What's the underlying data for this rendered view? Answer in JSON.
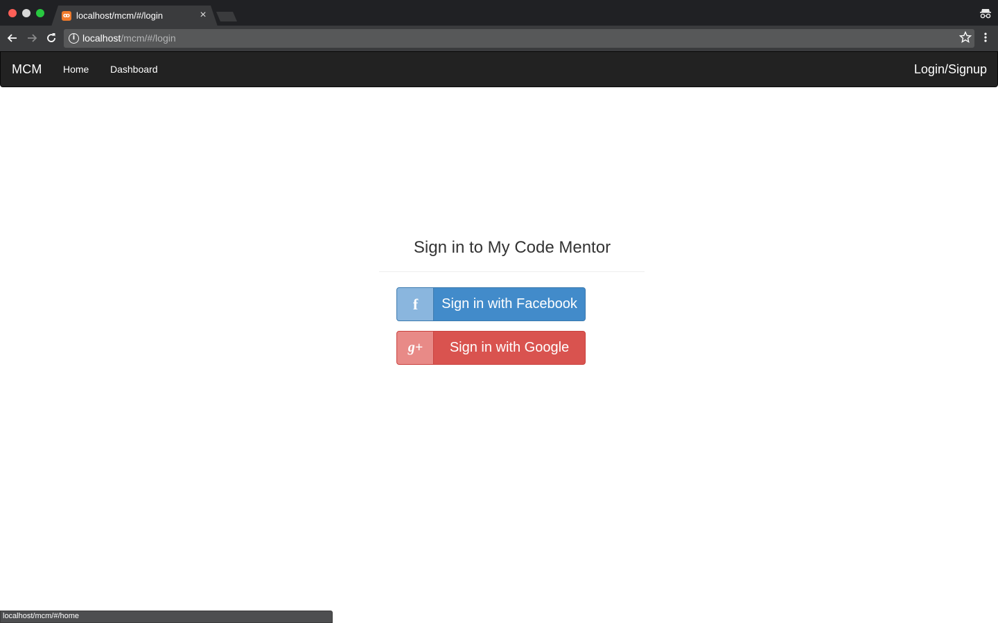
{
  "browser": {
    "tab": {
      "title": "localhost/mcm/#/login",
      "favicon": "xampp-icon",
      "close": "×"
    },
    "address": {
      "host": "localhost",
      "path": "/mcm/#/login"
    },
    "status_url": "localhost/mcm/#/home",
    "icons": {
      "back": "arrow-left-icon",
      "forward": "arrow-right-icon",
      "reload": "reload-icon",
      "info": "info-icon",
      "bookmark": "star-icon",
      "menu": "kebab-menu-icon",
      "incognito": "incognito-icon"
    }
  },
  "navbar": {
    "brand": "MCM",
    "links": [
      "Home",
      "Dashboard"
    ],
    "login": "Login/Signup"
  },
  "main": {
    "title": "Sign in to My Code Mentor",
    "buttons": {
      "facebook": {
        "label": "Sign in with Facebook",
        "icon": "f",
        "color": "#428bca"
      },
      "google": {
        "label": "Sign in with Google",
        "icon": "g+",
        "color": "#d9534f"
      }
    }
  }
}
